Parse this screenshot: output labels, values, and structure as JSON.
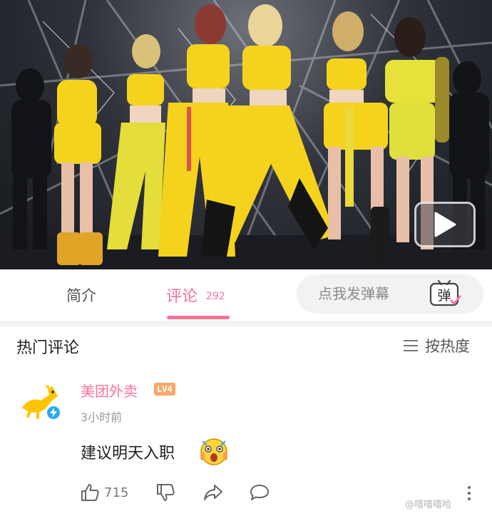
{
  "tabs": {
    "intro_label": "简介",
    "comments_label": "评论",
    "comments_count": "292"
  },
  "danmaku": {
    "placeholder": "点我发弹幕",
    "icon_glyph": "弹"
  },
  "comments_section": {
    "title": "热门评论",
    "sort_label": "按热度"
  },
  "comment": {
    "username": "美团外卖",
    "level_badge": "LV4",
    "time": "3小时前",
    "text": "建议明天入职",
    "likes": "715"
  },
  "watermark": "@嘻嘻嘻哈",
  "colors": {
    "accent": "#fb7299",
    "outfit_yellow": "#f5d31d",
    "avatar_yellow": "#ffc300",
    "verified_blue": "#2ea7f4"
  },
  "icons": {
    "play": "play-icon",
    "danmaku": "danmaku-icon",
    "sort": "menu-lines-icon",
    "like": "thumbs-up-icon",
    "dislike": "thumbs-down-icon",
    "share": "share-icon",
    "reply": "reply-bubble-icon",
    "more": "more-vertical-icon"
  }
}
